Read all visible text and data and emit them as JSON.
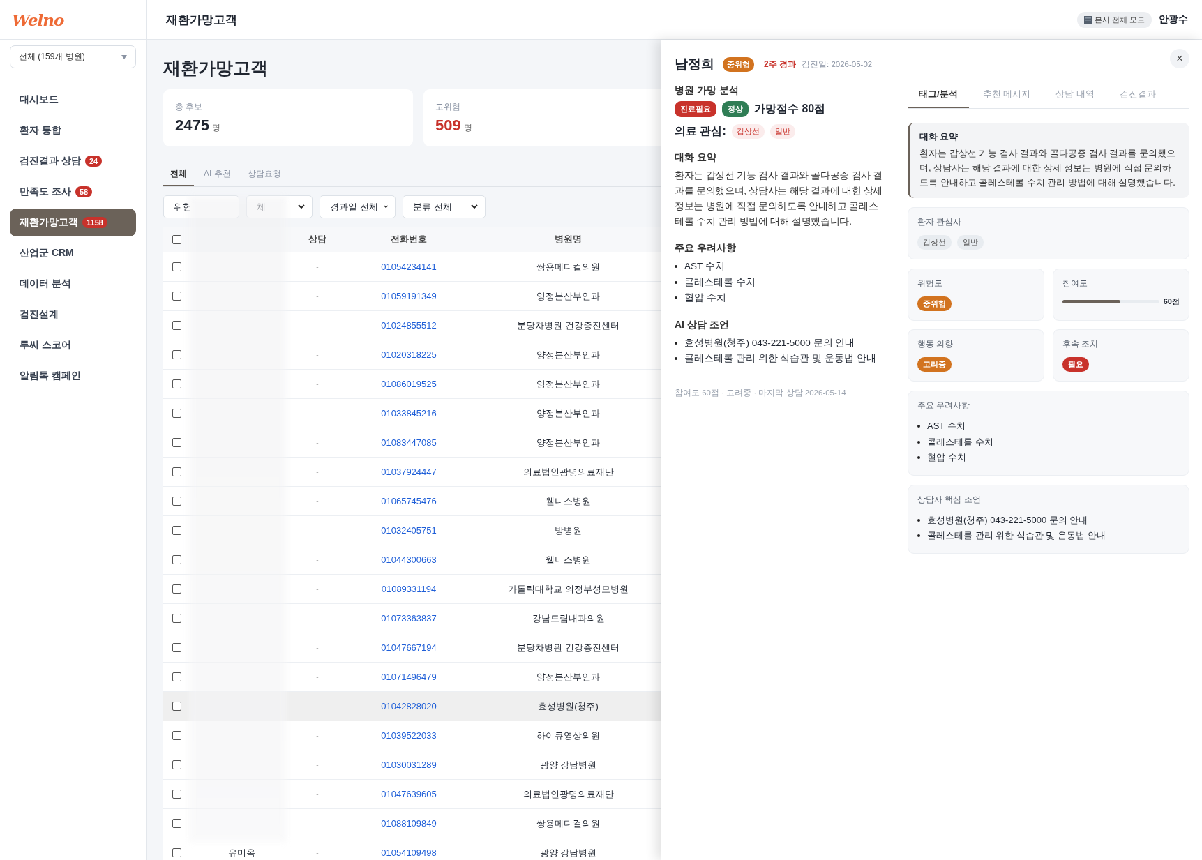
{
  "header": {
    "logo": "Welno",
    "title": "재환가망고객",
    "mode_badge": "본사 전체 모드",
    "user": "안광수"
  },
  "sidebar": {
    "hospital_select": "전체 (159개 병원)",
    "items": [
      {
        "label": "대시보드",
        "selected": false
      },
      {
        "label": "환자 통합",
        "selected": false
      },
      {
        "label": "검진결과 상담",
        "badge": "24",
        "selected": false
      },
      {
        "label": "만족도 조사",
        "badge": "58",
        "selected": false
      },
      {
        "label": "재환가망고객",
        "badge": "1158",
        "selected": true
      },
      {
        "label": "산업군 CRM",
        "selected": false
      },
      {
        "label": "데이터 분석",
        "selected": false
      },
      {
        "label": "검진설계",
        "selected": false
      },
      {
        "label": "루씨 스코어",
        "selected": false
      },
      {
        "label": "알림톡 캠페인",
        "selected": false
      }
    ]
  },
  "page": {
    "title": "재환가망고객",
    "stats": [
      {
        "label": "총 후보",
        "value": "2475",
        "unit": "명",
        "kind": "normal"
      },
      {
        "label": "고위험",
        "value": "509",
        "unit": "명",
        "kind": "danger"
      }
    ],
    "tabs": [
      {
        "label": "전체",
        "selected": true
      },
      {
        "label": "AI 추천",
        "selected": false
      },
      {
        "label": "상담요청",
        "selected": false
      }
    ],
    "filters": [
      "위험",
      "체",
      "경과일 전체",
      "분류 전체"
    ],
    "table": {
      "select_all_checked": false,
      "columns": [
        "상담",
        "전화번호",
        "병원명"
      ],
      "rows": [
        {
          "consult": "-",
          "phone": "01054234141",
          "hospital": "쌍용메디컬의원",
          "checked": false,
          "selected": false
        },
        {
          "consult": "-",
          "phone": "01059191349",
          "hospital": "양정분산부인과",
          "checked": false,
          "selected": false
        },
        {
          "consult": "-",
          "phone": "01024855512",
          "hospital": "분당차병원 건강증진센터",
          "checked": false,
          "selected": false
        },
        {
          "consult": "-",
          "phone": "01020318225",
          "hospital": "양정분산부인과",
          "checked": false,
          "selected": false
        },
        {
          "consult": "-",
          "phone": "01086019525",
          "hospital": "양정분산부인과",
          "checked": false,
          "selected": false
        },
        {
          "consult": "-",
          "phone": "01033845216",
          "hospital": "양정분산부인과",
          "checked": false,
          "selected": false
        },
        {
          "consult": "-",
          "phone": "01083447085",
          "hospital": "양정분산부인과",
          "checked": false,
          "selected": false
        },
        {
          "consult": "-",
          "phone": "01037924447",
          "hospital": "의료법인광명의료재단",
          "checked": false,
          "selected": false
        },
        {
          "consult": "-",
          "phone": "01065745476",
          "hospital": "웰니스병원",
          "checked": false,
          "selected": false
        },
        {
          "consult": "-",
          "phone": "01032405751",
          "hospital": "방병원",
          "checked": false,
          "selected": false
        },
        {
          "consult": "-",
          "phone": "01044300663",
          "hospital": "웰니스병원",
          "checked": false,
          "selected": false
        },
        {
          "consult": "-",
          "phone": "01089331194",
          "hospital": "가톨릭대학교 의정부성모병원",
          "checked": false,
          "selected": false
        },
        {
          "consult": "-",
          "phone": "01073363837",
          "hospital": "강남드림내과의원",
          "checked": false,
          "selected": false
        },
        {
          "consult": "-",
          "phone": "01047667194",
          "hospital": "분당차병원 건강증진센터",
          "checked": false,
          "selected": false
        },
        {
          "consult": "-",
          "phone": "01071496479",
          "hospital": "양정분산부인과",
          "checked": false,
          "selected": false
        },
        {
          "consult": "-",
          "phone": "01042828020",
          "hospital": "효성병원(청주)",
          "checked": false,
          "selected": true
        },
        {
          "consult": "-",
          "phone": "01039522033",
          "hospital": "하이큐영상의원",
          "checked": false,
          "selected": false
        },
        {
          "consult": "-",
          "phone": "01030031289",
          "hospital": "광양 강남병원",
          "checked": false,
          "selected": false
        },
        {
          "consult": "-",
          "phone": "01047639605",
          "hospital": "의료법인광명의료재단",
          "checked": false,
          "selected": false
        },
        {
          "consult": "-",
          "phone": "01088109849",
          "hospital": "쌍용메디컬의원",
          "checked": false,
          "selected": false
        },
        {
          "name": "유미옥",
          "consult": "-",
          "phone": "01054109498",
          "hospital": "광양 강남병원",
          "checked": false,
          "selected": false
        }
      ]
    }
  },
  "detail": {
    "name": "남정희",
    "risk": {
      "label": "중위험",
      "color": "#d2731f"
    },
    "elapsed": "2주 경과",
    "exam_date": "검진일: 2026-05-02",
    "analysis_heading": "병원 가망 분석",
    "analysis_tags": [
      {
        "label": "진료필요",
        "color": "#c8322b"
      },
      {
        "label": "정상",
        "color": "#2f7d55"
      }
    ],
    "score": "가망점수 80점",
    "interest_label": "의료 관심:",
    "interests": [
      "갑상선",
      "일반"
    ],
    "summary_heading": "대화 요약",
    "summary": "환자는 갑상선 기능 검사 결과와 골다공증 검사 결과를 문의했으며, 상담사는 해당 결과에 대한 상세 정보는 병원에 직접 문의하도록 안내하고 콜레스테롤 수치 관리 방법에 대해 설명했습니다.",
    "concerns_heading": "주요 우려사항",
    "concerns": [
      "AST 수치",
      "콜레스테롤 수치",
      "혈압 수치"
    ],
    "advice_heading": "AI 상담 조언",
    "advice": [
      "효성병원(청주) 043-221-5000 문의 안내",
      "콜레스테롤 관리 위한 식습관 및 운동법 안내"
    ],
    "footer": "참여도 60점 · 고려중 · 마지막 상담 2026-05-14",
    "close": "×",
    "tabs": [
      {
        "label": "태그/분석",
        "selected": true
      },
      {
        "label": "추천 메시지",
        "selected": false
      },
      {
        "label": "상담 내역",
        "selected": false
      },
      {
        "label": "검진결과",
        "selected": false
      }
    ],
    "summary_card": {
      "title": "대화 요약",
      "text": "환자는 갑상선 기능 검사 결과와 골다공증 검사 결과를 문의했으며, 상담사는 해당 결과에 대한 상세 정보는 병원에 직접 문의하도록 안내하고 콜레스테롤 수치 관리 방법에 대해 설명했습니다."
    },
    "interest_card": {
      "title": "환자 관심사",
      "chips": [
        "갑상선",
        "일반"
      ]
    },
    "metrics": [
      {
        "kind": "badge",
        "title": "위험도",
        "value": "중위험",
        "color": "#d2731f"
      },
      {
        "kind": "meter",
        "title": "참여도",
        "level": 0.6,
        "reading": "60점"
      },
      {
        "kind": "badge",
        "title": "행동 의향",
        "value": "고려중",
        "color": "#d2731f"
      },
      {
        "kind": "badge",
        "title": "후속 조치",
        "value": "필요",
        "color": "#c8322b"
      }
    ],
    "concern_card": {
      "title": "주요 우려사항",
      "items": [
        "AST 수치",
        "콜레스테롤 수치",
        "혈압 수치"
      ]
    },
    "advice_card": {
      "title": "상담사 핵심 조언",
      "items": [
        "효성병원(청주) 043-221-5000 문의 안내",
        "콜레스테롤 관리 위한 식습관 및 운동법 안내"
      ]
    }
  }
}
